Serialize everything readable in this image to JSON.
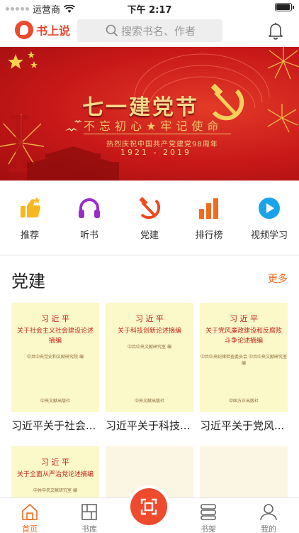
{
  "status": {
    "carrier": "运营商",
    "time": "下午 2:17",
    "battery_fraction": 0.95
  },
  "header": {
    "logo_text": "书上说",
    "search_placeholder": "搜索书名、作者",
    "icons": [
      "search-icon",
      "bell-icon"
    ]
  },
  "banner": {
    "title": "七一建党节",
    "slogan": "不忘初心★牢记使命",
    "subtitle": "热烈庆祝中国共产党建党98周年",
    "years": "1921 - 2019"
  },
  "nav": [
    {
      "label": "推荐",
      "icon": "thumbs-up-icon",
      "color": "#f6b81e"
    },
    {
      "label": "听书",
      "icon": "headphones-icon",
      "color": "#9a2ccc"
    },
    {
      "label": "党建",
      "icon": "hammer-sickle-icon",
      "color": "#ee4a1e"
    },
    {
      "label": "排行榜",
      "icon": "bar-chart-icon",
      "color": "#f26b1c"
    },
    {
      "label": "视频学习",
      "icon": "play-icon",
      "color": "#1aa3e8"
    }
  ],
  "section": {
    "title": "党建",
    "more": "更多",
    "books": [
      {
        "name": "习近平关于社会...",
        "cover_author": "习 近 平",
        "cover_title": "关于社会主义社会建设论述摘编",
        "cover_pub": "中共中央党史和文献研究院 编",
        "cover_press": "中央文献出版社"
      },
      {
        "name": "习近平关于科技...",
        "cover_author": "习 近 平",
        "cover_title": "关于科技创新论述摘编",
        "cover_pub": "中共中央文献研究室 编",
        "cover_press": "中央文献出版社"
      },
      {
        "name": "习近平关于党风...",
        "cover_author": "习 近 平",
        "cover_title": "关于党风廉政建设和反腐败斗争论述摘编",
        "cover_pub": "中共中央纪律检查委员会 中共中央文献研究室 编",
        "cover_press": "中国方正出版社"
      },
      {
        "name": "",
        "cover_author": "习 近 平",
        "cover_title": "关于全面从严治党论述摘编",
        "cover_pub": "中共中央文献研究室 编",
        "cover_press": ""
      },
      {
        "name": "",
        "cover_author": "",
        "cover_title": "",
        "cover_pub": "",
        "cover_press": ""
      },
      {
        "name": "",
        "cover_author": "",
        "cover_title": "",
        "cover_pub": "",
        "cover_press": ""
      }
    ]
  },
  "tabbar": [
    {
      "label": "首页",
      "icon": "home-icon",
      "active": true
    },
    {
      "label": "书库",
      "icon": "library-icon",
      "active": false
    },
    {
      "label": "",
      "icon": "scan-icon",
      "active": false
    },
    {
      "label": "书架",
      "icon": "bookshelf-icon",
      "active": false
    },
    {
      "label": "我的",
      "icon": "user-icon",
      "active": false
    }
  ]
}
